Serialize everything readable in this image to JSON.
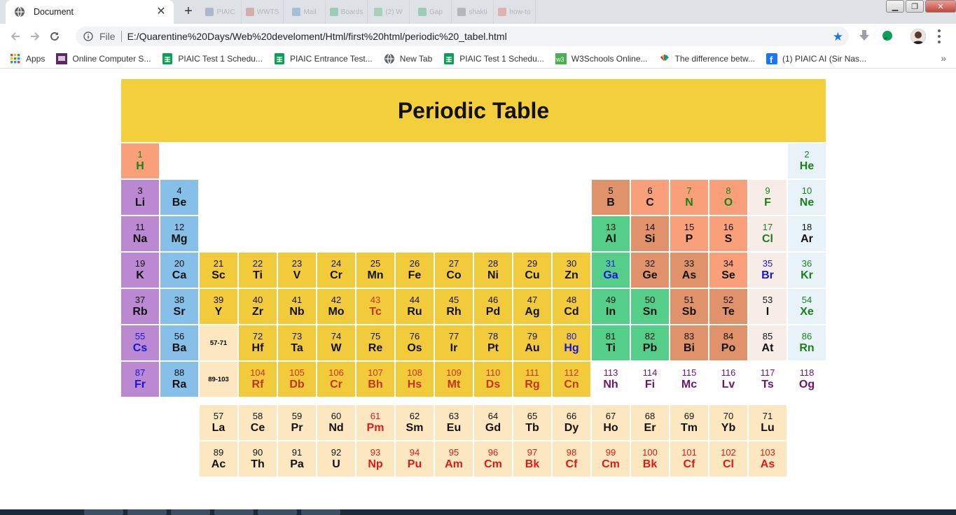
{
  "browser": {
    "tab_title": "Document",
    "scheme": "File",
    "url": "E:/Quarentine%20Days/Web%20develoment/Html/first%20html/periodic%20_tabel.html",
    "faded_tabs": [
      "PIAIC",
      "WWTS",
      "Mail",
      "Boards",
      "(2) W",
      "Gap",
      "shakti",
      "how-to"
    ]
  },
  "bookmarks": [
    {
      "label": "Apps",
      "icon": "apps-grid-icon"
    },
    {
      "label": "Online Computer S...",
      "icon": "site-favicon-icon"
    },
    {
      "label": "PIAIC Test 1 Schedu...",
      "icon": "sheets-icon"
    },
    {
      "label": "PIAIC Entrance Test...",
      "icon": "sheets-icon"
    },
    {
      "label": "New Tab",
      "icon": "globe-icon"
    },
    {
      "label": "PIAIC Test 1 Schedu...",
      "icon": "sheets-icon"
    },
    {
      "label": "W3Schools Online...",
      "icon": "w3schools-icon"
    },
    {
      "label": "The difference betw...",
      "icon": "nbc-icon"
    },
    {
      "label": "(1) PIAIC AI (Sir Nas...",
      "icon": "facebook-icon"
    }
  ],
  "page": {
    "title": "Periodic Table",
    "placeholder_lanthanides": "57-71",
    "placeholder_actinides": "89-103"
  },
  "rows": [
    [
      {
        "n": "1",
        "s": "H",
        "c": "c-h",
        "t": "t-green"
      },
      {
        "skip": 16
      },
      {
        "n": "2",
        "s": "He",
        "c": "c-ng",
        "t": "t-green"
      }
    ],
    [
      {
        "n": "3",
        "s": "Li",
        "c": "c-alk",
        "t": "t-black"
      },
      {
        "n": "4",
        "s": "Be",
        "c": "c-ae",
        "t": "t-black"
      },
      {
        "skip": 10
      },
      {
        "n": "5",
        "s": "B",
        "c": "c-met",
        "t": "t-black"
      },
      {
        "n": "6",
        "s": "C",
        "c": "c-nm",
        "t": "t-black"
      },
      {
        "n": "7",
        "s": "N",
        "c": "c-nm",
        "t": "t-green"
      },
      {
        "n": "8",
        "s": "O",
        "c": "c-nm",
        "t": "t-green"
      },
      {
        "n": "9",
        "s": "F",
        "c": "c-hal",
        "t": "t-green"
      },
      {
        "n": "10",
        "s": "Ne",
        "c": "c-ng",
        "t": "t-green"
      }
    ],
    [
      {
        "n": "11",
        "s": "Na",
        "c": "c-alk",
        "t": "t-black"
      },
      {
        "n": "12",
        "s": "Mg",
        "c": "c-ae",
        "t": "t-black"
      },
      {
        "skip": 10
      },
      {
        "n": "13",
        "s": "Al",
        "c": "c-pt",
        "t": "t-black"
      },
      {
        "n": "14",
        "s": "Si",
        "c": "c-met",
        "t": "t-black"
      },
      {
        "n": "15",
        "s": "P",
        "c": "c-nm",
        "t": "t-black"
      },
      {
        "n": "16",
        "s": "S",
        "c": "c-nm",
        "t": "t-black"
      },
      {
        "n": "17",
        "s": "Cl",
        "c": "c-hal",
        "t": "t-green"
      },
      {
        "n": "18",
        "s": "Ar",
        "c": "c-ng",
        "t": "t-black"
      }
    ],
    [
      {
        "n": "19",
        "s": "K",
        "c": "c-alk",
        "t": "t-black"
      },
      {
        "n": "20",
        "s": "Ca",
        "c": "c-ae",
        "t": "t-black"
      },
      {
        "n": "21",
        "s": "Sc",
        "c": "c-tm",
        "t": "t-black"
      },
      {
        "n": "22",
        "s": "Ti",
        "c": "c-tm",
        "t": "t-black"
      },
      {
        "n": "23",
        "s": "V",
        "c": "c-tm",
        "t": "t-black"
      },
      {
        "n": "24",
        "s": "Cr",
        "c": "c-tm",
        "t": "t-black"
      },
      {
        "n": "25",
        "s": "Mn",
        "c": "c-tm",
        "t": "t-black"
      },
      {
        "n": "26",
        "s": "Fe",
        "c": "c-tm",
        "t": "t-black"
      },
      {
        "n": "27",
        "s": "Co",
        "c": "c-tm",
        "t": "t-black"
      },
      {
        "n": "28",
        "s": "Ni",
        "c": "c-tm",
        "t": "t-black"
      },
      {
        "n": "29",
        "s": "Cu",
        "c": "c-tm",
        "t": "t-black"
      },
      {
        "n": "30",
        "s": "Zn",
        "c": "c-tm",
        "t": "t-black"
      },
      {
        "n": "31",
        "s": "Ga",
        "c": "c-pt",
        "t": "t-blue"
      },
      {
        "n": "32",
        "s": "Ge",
        "c": "c-met",
        "t": "t-black"
      },
      {
        "n": "33",
        "s": "As",
        "c": "c-met",
        "t": "t-black"
      },
      {
        "n": "34",
        "s": "Se",
        "c": "c-nm",
        "t": "t-black"
      },
      {
        "n": "35",
        "s": "Br",
        "c": "c-hal",
        "t": "t-blue"
      },
      {
        "n": "36",
        "s": "Kr",
        "c": "c-ng",
        "t": "t-green"
      }
    ],
    [
      {
        "n": "37",
        "s": "Rb",
        "c": "c-alk",
        "t": "t-black"
      },
      {
        "n": "38",
        "s": "Sr",
        "c": "c-ae",
        "t": "t-black"
      },
      {
        "n": "39",
        "s": "Y",
        "c": "c-tm",
        "t": "t-black"
      },
      {
        "n": "40",
        "s": "Zr",
        "c": "c-tm",
        "t": "t-black"
      },
      {
        "n": "41",
        "s": "Nb",
        "c": "c-tm",
        "t": "t-black"
      },
      {
        "n": "42",
        "s": "Mo",
        "c": "c-tm",
        "t": "t-black"
      },
      {
        "n": "43",
        "s": "Tc",
        "c": "c-tm",
        "t": "t-red"
      },
      {
        "n": "44",
        "s": "Ru",
        "c": "c-tm",
        "t": "t-black"
      },
      {
        "n": "45",
        "s": "Rh",
        "c": "c-tm",
        "t": "t-black"
      },
      {
        "n": "46",
        "s": "Pd",
        "c": "c-tm",
        "t": "t-black"
      },
      {
        "n": "47",
        "s": "Ag",
        "c": "c-tm",
        "t": "t-black"
      },
      {
        "n": "48",
        "s": "Cd",
        "c": "c-tm",
        "t": "t-black"
      },
      {
        "n": "49",
        "s": "In",
        "c": "c-pt",
        "t": "t-black"
      },
      {
        "n": "50",
        "s": "Sn",
        "c": "c-pt",
        "t": "t-black"
      },
      {
        "n": "51",
        "s": "Sb",
        "c": "c-met",
        "t": "t-black"
      },
      {
        "n": "52",
        "s": "Te",
        "c": "c-met",
        "t": "t-black"
      },
      {
        "n": "53",
        "s": "I",
        "c": "c-hal",
        "t": "t-black"
      },
      {
        "n": "54",
        "s": "Xe",
        "c": "c-ng",
        "t": "t-green"
      }
    ],
    [
      {
        "n": "55",
        "s": "Cs",
        "c": "c-alk",
        "t": "t-blue"
      },
      {
        "n": "56",
        "s": "Ba",
        "c": "c-ae",
        "t": "t-black"
      },
      {
        "note": "57-71",
        "c": "c-lan"
      },
      {
        "n": "72",
        "s": "Hf",
        "c": "c-tm",
        "t": "t-black"
      },
      {
        "n": "73",
        "s": "Ta",
        "c": "c-tm",
        "t": "t-black"
      },
      {
        "n": "74",
        "s": "W",
        "c": "c-tm",
        "t": "t-black"
      },
      {
        "n": "75",
        "s": "Re",
        "c": "c-tm",
        "t": "t-black"
      },
      {
        "n": "76",
        "s": "Os",
        "c": "c-tm",
        "t": "t-black"
      },
      {
        "n": "77",
        "s": "Ir",
        "c": "c-tm",
        "t": "t-black"
      },
      {
        "n": "78",
        "s": "Pt",
        "c": "c-tm",
        "t": "t-black"
      },
      {
        "n": "79",
        "s": "Au",
        "c": "c-tm",
        "t": "t-black"
      },
      {
        "n": "80",
        "s": "Hg",
        "c": "c-tm",
        "t": "t-blue"
      },
      {
        "n": "81",
        "s": "Ti",
        "c": "c-pt",
        "t": "t-black"
      },
      {
        "n": "82",
        "s": "Pb",
        "c": "c-pt",
        "t": "t-black"
      },
      {
        "n": "83",
        "s": "Bi",
        "c": "c-met",
        "t": "t-black"
      },
      {
        "n": "84",
        "s": "Po",
        "c": "c-met",
        "t": "t-black"
      },
      {
        "n": "85",
        "s": "At",
        "c": "c-hal",
        "t": "t-black"
      },
      {
        "n": "86",
        "s": "Rn",
        "c": "c-ng",
        "t": "t-green"
      }
    ],
    [
      {
        "n": "87",
        "s": "Fr",
        "c": "c-alk",
        "t": "t-blue"
      },
      {
        "n": "88",
        "s": "Ra",
        "c": "c-ae",
        "t": "t-black"
      },
      {
        "note": "89-103",
        "c": "c-lan"
      },
      {
        "n": "104",
        "s": "Rf",
        "c": "c-tm",
        "t": "t-red"
      },
      {
        "n": "105",
        "s": "Db",
        "c": "c-tm",
        "t": "t-red"
      },
      {
        "n": "106",
        "s": "Cr",
        "c": "c-tm",
        "t": "t-red"
      },
      {
        "n": "107",
        "s": "Bh",
        "c": "c-tm",
        "t": "t-red"
      },
      {
        "n": "108",
        "s": "Hs",
        "c": "c-tm",
        "t": "t-red"
      },
      {
        "n": "109",
        "s": "Mt",
        "c": "c-tm",
        "t": "t-red"
      },
      {
        "n": "110",
        "s": "Ds",
        "c": "c-tm",
        "t": "t-red"
      },
      {
        "n": "111",
        "s": "Rg",
        "c": "c-tm",
        "t": "t-red"
      },
      {
        "n": "112",
        "s": "Cn",
        "c": "c-tm",
        "t": "t-red"
      },
      {
        "n": "113",
        "s": "Nh",
        "c": "c-un",
        "t": "t-purple"
      },
      {
        "n": "114",
        "s": "Fi",
        "c": "c-un",
        "t": "t-purple"
      },
      {
        "n": "115",
        "s": "Mc",
        "c": "c-un",
        "t": "t-purple"
      },
      {
        "n": "116",
        "s": "Lv",
        "c": "c-un",
        "t": "t-purple"
      },
      {
        "n": "117",
        "s": "Ts",
        "c": "c-un",
        "t": "t-purple"
      },
      {
        "n": "118",
        "s": "Og",
        "c": "c-un",
        "t": "t-purple"
      }
    ]
  ],
  "lanthanides": [
    {
      "n": "57",
      "s": "La",
      "t": "t-black"
    },
    {
      "n": "58",
      "s": "Ce",
      "t": "t-black"
    },
    {
      "n": "59",
      "s": "Pr",
      "t": "t-black"
    },
    {
      "n": "60",
      "s": "Nd",
      "t": "t-black"
    },
    {
      "n": "61",
      "s": "Pm",
      "t": "t-bright"
    },
    {
      "n": "62",
      "s": "Sm",
      "t": "t-black"
    },
    {
      "n": "63",
      "s": "Eu",
      "t": "t-black"
    },
    {
      "n": "64",
      "s": "Gd",
      "t": "t-black"
    },
    {
      "n": "65",
      "s": "Tb",
      "t": "t-black"
    },
    {
      "n": "66",
      "s": "Dy",
      "t": "t-black"
    },
    {
      "n": "67",
      "s": "Ho",
      "t": "t-black"
    },
    {
      "n": "68",
      "s": "Er",
      "t": "t-black"
    },
    {
      "n": "69",
      "s": "Tm",
      "t": "t-black"
    },
    {
      "n": "70",
      "s": "Yb",
      "t": "t-black"
    },
    {
      "n": "71",
      "s": "Lu",
      "t": "t-black"
    }
  ],
  "actinides": [
    {
      "n": "89",
      "s": "Ac",
      "t": "t-black"
    },
    {
      "n": "90",
      "s": "Th",
      "t": "t-black"
    },
    {
      "n": "91",
      "s": "Pa",
      "t": "t-black"
    },
    {
      "n": "92",
      "s": "U",
      "t": "t-black"
    },
    {
      "n": "93",
      "s": "Np",
      "t": "t-bright"
    },
    {
      "n": "94",
      "s": "Pu",
      "t": "t-bright"
    },
    {
      "n": "95",
      "s": "Am",
      "t": "t-bright"
    },
    {
      "n": "96",
      "s": "Cm",
      "t": "t-bright"
    },
    {
      "n": "97",
      "s": "Bk",
      "t": "t-bright"
    },
    {
      "n": "98",
      "s": "Cf",
      "t": "t-bright"
    },
    {
      "n": "99",
      "s": "Cm",
      "t": "t-bright"
    },
    {
      "n": "100",
      "s": "Bk",
      "t": "t-bright"
    },
    {
      "n": "101",
      "s": "Cf",
      "t": "t-bright"
    },
    {
      "n": "102",
      "s": "Cl",
      "t": "t-bright"
    },
    {
      "n": "103",
      "s": "As",
      "t": "t-bright"
    }
  ],
  "colors": {
    "header": "#f2cf3b",
    "transition_metal": "#f2cb3c",
    "alkali_metal": "#bb89d1",
    "alkaline_earth": "#86c0e8",
    "post_transition": "#54ce88",
    "metalloid": "#e0936a",
    "nonmetal": "#f9a07a",
    "halogen": "#f8ece6",
    "noble_gas": "#e8f3f9",
    "lanthanide_actinide": "#fde7c1"
  }
}
